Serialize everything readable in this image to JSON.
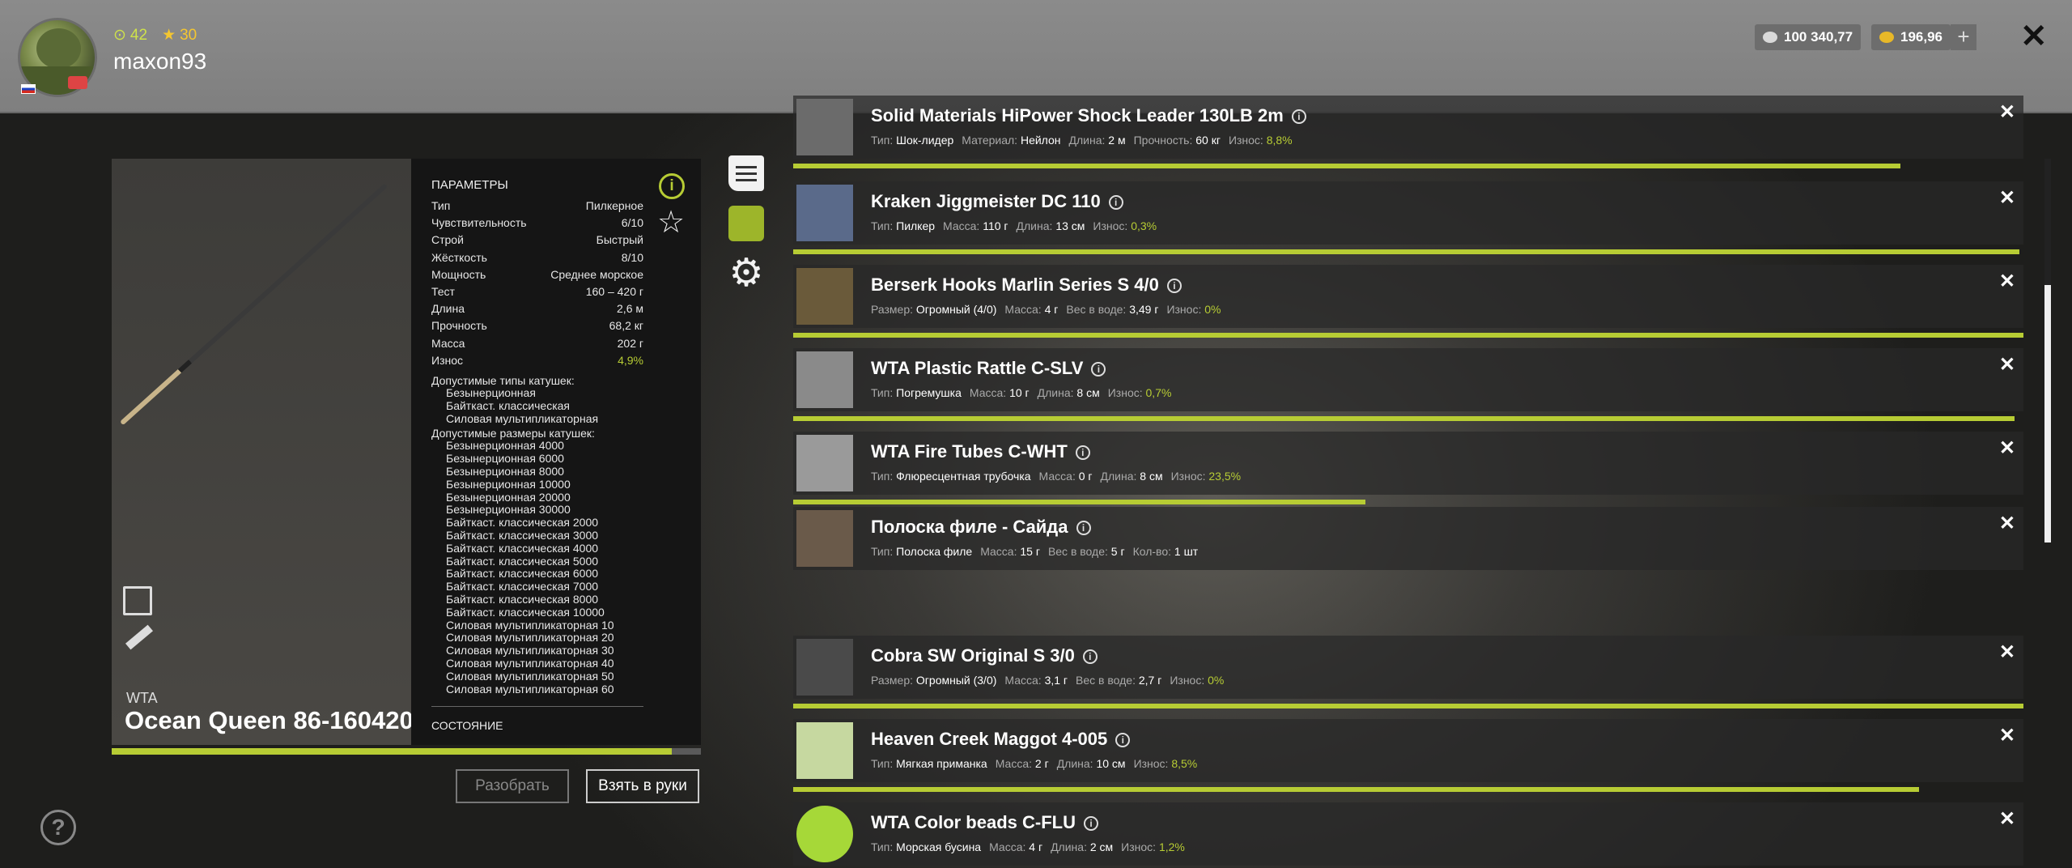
{
  "profile": {
    "level": "42",
    "rank": "30",
    "username": "maxon93"
  },
  "currency": {
    "silver": "100 340,77",
    "gold": "196,96",
    "add": "+"
  },
  "close": "✕",
  "rod": {
    "brand": "WTA",
    "name": "Ocean Queen 86-160420",
    "wear_fraction": 0.951
  },
  "params": {
    "title": "ПАРАМЕТРЫ",
    "rows": [
      {
        "label": "Тип",
        "value": "Пилкерное"
      },
      {
        "label": "Чувствительность",
        "value": "6/10"
      },
      {
        "label": "Строй",
        "value": "Быстрый"
      },
      {
        "label": "Жёсткость",
        "value": "8/10"
      },
      {
        "label": "Мощность",
        "value": "Среднее морское"
      },
      {
        "label": "Тест",
        "value": "160 – 420 г"
      },
      {
        "label": "Длина",
        "value": "2,6 м"
      },
      {
        "label": "Прочность",
        "value": "68,2 кг"
      },
      {
        "label": "Масса",
        "value": "202 г"
      },
      {
        "label": "Износ",
        "value": "4,9%"
      }
    ],
    "reel_types_label": "Допустимые типы катушек:",
    "reel_types": [
      "Безынерционная",
      "Байткаст. классическая",
      "Силовая мультипликаторная"
    ],
    "reel_sizes_label": "Допустимые размеры катушек:",
    "reel_sizes": [
      "Безынерционная 4000",
      "Безынерционная 6000",
      "Безынерционная 8000",
      "Безынерционная 10000",
      "Безынерционная 20000",
      "Безынерционная 30000",
      "Байткаст. классическая 2000",
      "Байткаст. классическая 3000",
      "Байткаст. классическая 4000",
      "Байткаст. классическая 5000",
      "Байткаст. классическая 6000",
      "Байткаст. классическая 7000",
      "Байткаст. классическая 8000",
      "Байткаст. классическая 10000",
      "Силовая мультипликаторная 10",
      "Силовая мультипликаторная 20",
      "Силовая мультипликаторная 30",
      "Силовая мультипликаторная 40",
      "Силовая мультипликаторная 50",
      "Силовая мультипликаторная 60"
    ],
    "state": "СОСТОЯНИЕ"
  },
  "buttons": {
    "disassemble": "Разобрать",
    "take": "Взять в руки"
  },
  "icons": {
    "info": "i",
    "star": "☆",
    "gear": "⚙",
    "help": "?",
    "item_close": "✕"
  },
  "items": [
    {
      "name": "Solid Materials HiPower Shock Leader 130LB 2m",
      "meta": [
        [
          "Тип:",
          "Шок-лидер"
        ],
        [
          "Материал:",
          "Нейлон"
        ],
        [
          "Длина:",
          "2 м"
        ],
        [
          "Прочность:",
          "60 кг"
        ],
        [
          "Износ:",
          "8,8%"
        ]
      ],
      "wear": 0.9
    },
    {
      "name": "Kraken Jiggmeister DC 110",
      "meta": [
        [
          "Тип:",
          "Пилкер"
        ],
        [
          "Масса:",
          "110 г"
        ],
        [
          "Длина:",
          "13 см"
        ],
        [
          "Износ:",
          "0,3%"
        ]
      ],
      "wear": 0.997
    },
    {
      "name": "Berserk Hooks Marlin Series S 4/0",
      "meta": [
        [
          "Размер:",
          "Огромный (4/0)"
        ],
        [
          "Масса:",
          "4 г"
        ],
        [
          "Вес в воде:",
          "3,49 г"
        ],
        [
          "Износ:",
          "0%"
        ]
      ],
      "wear": 1.0
    },
    {
      "name": "WTA Plastic Rattle C-SLV",
      "meta": [
        [
          "Тип:",
          "Погремушка"
        ],
        [
          "Масса:",
          "10 г"
        ],
        [
          "Длина:",
          "8 см"
        ],
        [
          "Износ:",
          "0,7%"
        ]
      ],
      "wear": 0.993
    },
    {
      "name": "WTA Fire Tubes C-WHT",
      "meta": [
        [
          "Тип:",
          "Флюресцентная трубочка"
        ],
        [
          "Масса:",
          "0 г"
        ],
        [
          "Длина:",
          "8 см"
        ],
        [
          "Износ:",
          "23,5%"
        ]
      ],
      "wear": 0.465
    },
    {
      "name": "Полоска филе - Сайда",
      "meta": [
        [
          "Тип:",
          "Полоска филе"
        ],
        [
          "Масса:",
          "15 г"
        ],
        [
          "Вес в воде:",
          "5 г"
        ],
        [
          "Кол-во:",
          "1 шт"
        ]
      ],
      "wear": null
    },
    {
      "name": "Cobra SW Original S 3/0",
      "meta": [
        [
          "Размер:",
          "Огромный (3/0)"
        ],
        [
          "Масса:",
          "3,1 г"
        ],
        [
          "Вес в воде:",
          "2,7 г"
        ],
        [
          "Износ:",
          "0%"
        ]
      ],
      "wear": 1.0
    },
    {
      "name": "Heaven Creek Maggot 4-005",
      "meta": [
        [
          "Тип:",
          "Мягкая приманка"
        ],
        [
          "Масса:",
          "2 г"
        ],
        [
          "Длина:",
          "10 см"
        ],
        [
          "Износ:",
          "8,5%"
        ]
      ],
      "wear": 0.915
    },
    {
      "name": "WTA Color beads C-FLU",
      "meta": [
        [
          "Тип:",
          "Морская бусина"
        ],
        [
          "Масса:",
          "4 г"
        ],
        [
          "Длина:",
          "2 см"
        ],
        [
          "Износ:",
          "1,2%"
        ]
      ],
      "wear": 0.988
    }
  ]
}
